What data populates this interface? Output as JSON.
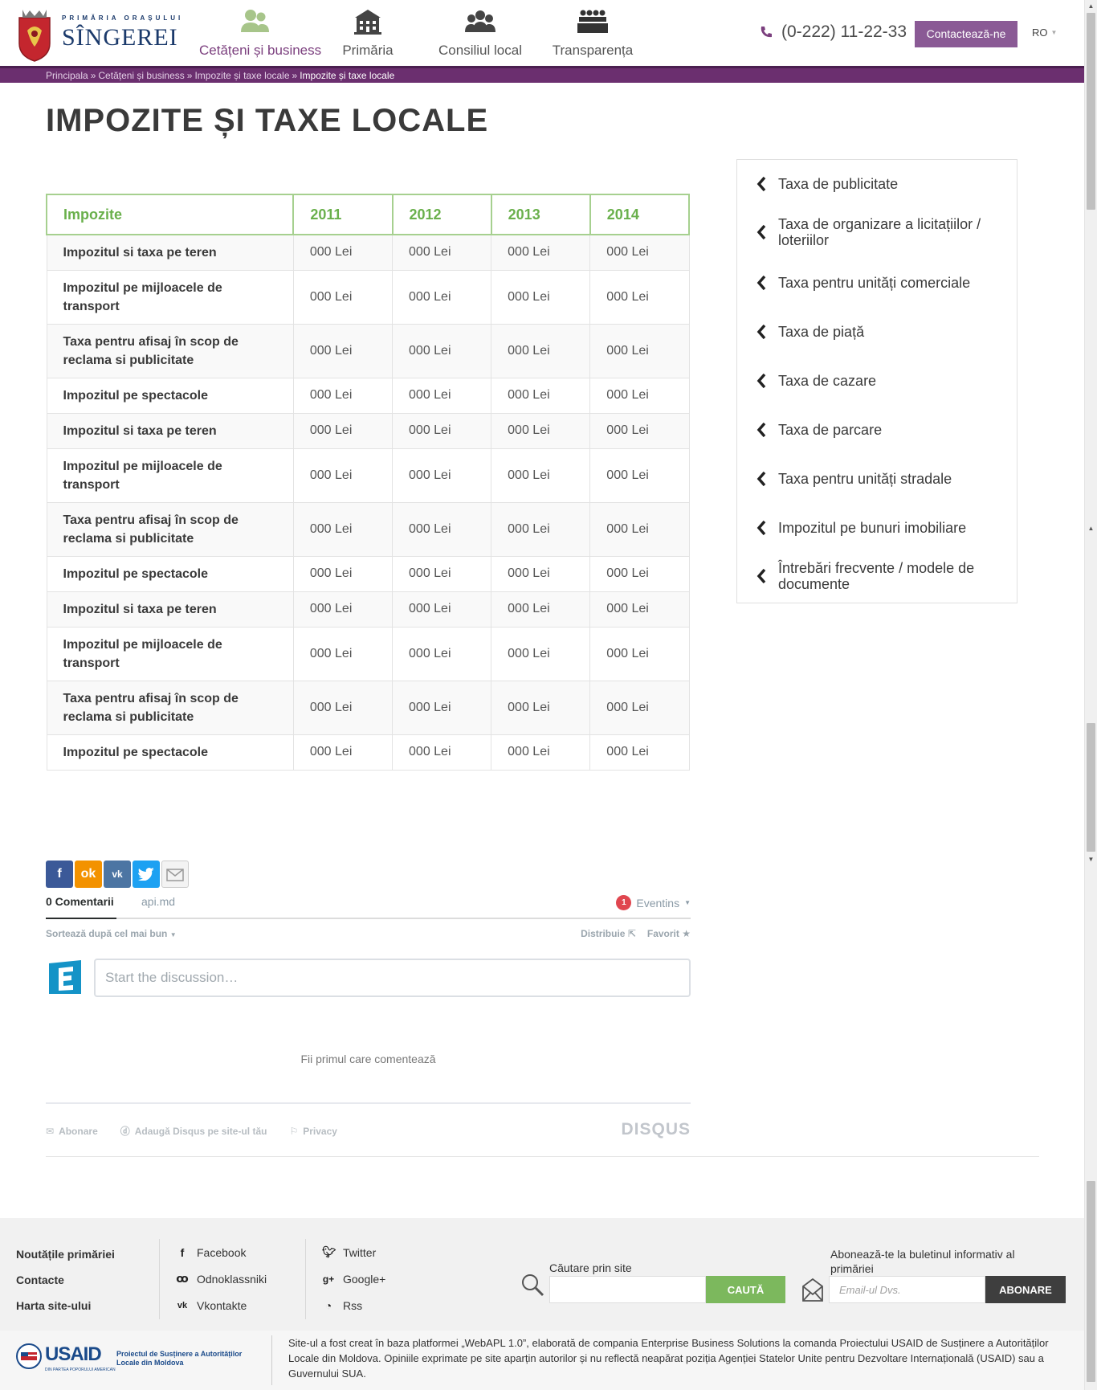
{
  "brand": {
    "top_line": "PRIMĂRIA ORAȘULUI",
    "name": "SÎNGEREI",
    "colors": {
      "primary": "#6b2f6f",
      "accent_green": "#6ab04c",
      "button_purple": "#8a5a95"
    }
  },
  "nav": {
    "items": [
      {
        "label": "Cetățeni și business",
        "icon": "people-icon",
        "active": true
      },
      {
        "label": "Primăria",
        "icon": "building-icon",
        "active": false
      },
      {
        "label": "Consiliul local",
        "icon": "council-icon",
        "active": false
      },
      {
        "label": "Transparența",
        "icon": "meeting-icon",
        "active": false
      }
    ]
  },
  "header": {
    "phone": "(0-222) 11-22-33",
    "contact_button": "Contactează-ne",
    "language": "RO"
  },
  "breadcrumb": {
    "items": [
      "Principala",
      "Cetățeni și business",
      "Impozite și taxe locale"
    ],
    "separator": "»",
    "current": "Impozite și taxe locale"
  },
  "page": {
    "title": "IMPOZITE ȘI TAXE LOCALE"
  },
  "table": {
    "headers": [
      "Impozite",
      "2011",
      "2012",
      "2013",
      "2014"
    ],
    "rows": [
      {
        "name": "Impozitul si taxa pe teren",
        "values": [
          "000 Lei",
          "000 Lei",
          "000 Lei",
          "000 Lei"
        ]
      },
      {
        "name": "Impozitul pe mijloacele de transport",
        "values": [
          "000 Lei",
          "000 Lei",
          "000 Lei",
          "000 Lei"
        ]
      },
      {
        "name": "Taxa pentru afisaj în scop de reclama si publicitate",
        "values": [
          "000 Lei",
          "000 Lei",
          "000 Lei",
          "000 Lei"
        ]
      },
      {
        "name": "Impozitul pe spectacole",
        "values": [
          "000 Lei",
          "000 Lei",
          "000 Lei",
          "000 Lei"
        ]
      },
      {
        "name": "Impozitul si taxa pe teren",
        "values": [
          "000 Lei",
          "000 Lei",
          "000 Lei",
          "000 Lei"
        ]
      },
      {
        "name": "Impozitul pe mijloacele de transport",
        "values": [
          "000 Lei",
          "000 Lei",
          "000 Lei",
          "000 Lei"
        ]
      },
      {
        "name": "Taxa pentru afisaj în scop de reclama si publicitate",
        "values": [
          "000 Lei",
          "000 Lei",
          "000 Lei",
          "000 Lei"
        ]
      },
      {
        "name": "Impozitul pe spectacole",
        "values": [
          "000 Lei",
          "000 Lei",
          "000 Lei",
          "000 Lei"
        ]
      },
      {
        "name": "Impozitul si taxa pe teren",
        "values": [
          "000 Lei",
          "000 Lei",
          "000 Lei",
          "000 Lei"
        ]
      },
      {
        "name": "Impozitul pe mijloacele de transport",
        "values": [
          "000 Lei",
          "000 Lei",
          "000 Lei",
          "000 Lei"
        ]
      },
      {
        "name": "Taxa pentru afisaj în scop de reclama si publicitate",
        "values": [
          "000 Lei",
          "000 Lei",
          "000 Lei",
          "000 Lei"
        ]
      },
      {
        "name": "Impozitul pe spectacole",
        "values": [
          "000 Lei",
          "000 Lei",
          "000 Lei",
          "000 Lei"
        ]
      }
    ]
  },
  "sidebar": {
    "items": [
      "Taxa de publicitate",
      "Taxa de organizare a licitațiilor / loteriilor",
      "Taxa pentru unități comerciale",
      "Taxa de piață",
      "Taxa de cazare",
      "Taxa de parcare",
      "Taxa pentru unități stradale",
      "Impozitul pe bunuri imobiliare",
      "Întrebări frecvente / modele de documente"
    ]
  },
  "share": {
    "buttons": [
      "facebook-icon",
      "odnoklassniki-icon",
      "vkontakte-icon",
      "twitter-icon",
      "email-icon"
    ]
  },
  "comments": {
    "count_tab": "0 Comentarii",
    "site_tab": "api.md",
    "notification_count": "1",
    "user": "Eventins",
    "sort": "Sortează după cel mai bun",
    "share": "Distribuie",
    "favorite": "Favorit",
    "placeholder": "Start the discussion…",
    "first": "Fii primul care comentează",
    "footer_links": [
      "Abonare",
      "Adaugă Disqus pe site-ul tău",
      "Privacy"
    ],
    "brand": "DISQUS"
  },
  "footer": {
    "links": [
      "Noutățile primăriei",
      "Contacte",
      "Harta site-ului"
    ],
    "social_col1": [
      {
        "label": "Facebook",
        "icon": "facebook-icon"
      },
      {
        "label": "Odnoklassniki",
        "icon": "odnoklassniki-icon"
      },
      {
        "label": "Vkontakte",
        "icon": "vkontakte-icon"
      }
    ],
    "social_col2": [
      {
        "label": "Twitter",
        "icon": "twitter-icon"
      },
      {
        "label": "Google+",
        "icon": "google-plus-icon"
      },
      {
        "label": "Rss",
        "icon": "rss-icon"
      }
    ],
    "search_label": "Căutare prin site",
    "search_button": "CAUTĂ",
    "subscribe_label": "Abonează-te la buletinul informativ al primăriei",
    "subscribe_placeholder": "Email-ul Dvs.",
    "subscribe_button": "ABONARE",
    "usaid_logo": "USAID",
    "usaid_sub": "DIN PARTEA POPORULUI AMERICAN",
    "usaid_project": "Proiectul de Susținere a Autorităților Locale din Moldova",
    "disclaimer": "Site-ul a fost creat în baza platformei „WebAPL 1.0”, elaborată de compania Enterprise Business Solutions la comanda Proiectului USAID de Susținere a Autorităților Locale din Moldova. Opiniile exprimate pe site aparțin autorilor și nu reflectă neapărat poziția Agenției Statelor Unite pentru Dezvoltare Internațională (USAID) sau a Guvernului SUA."
  }
}
